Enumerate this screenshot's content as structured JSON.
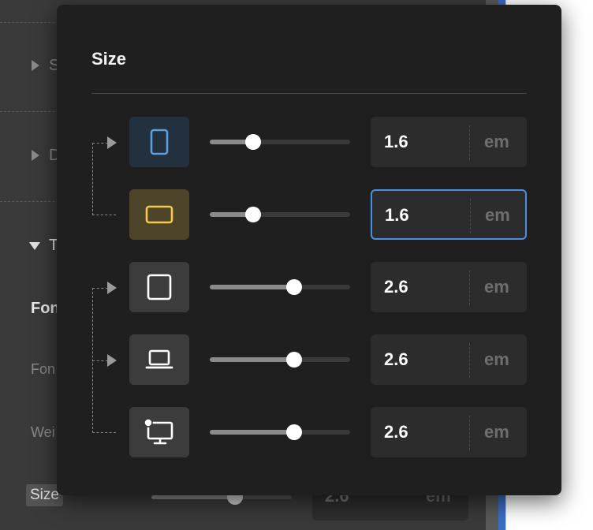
{
  "background_panel": {
    "sections": [
      {
        "label": "S"
      },
      {
        "label": "D"
      },
      {
        "label": "T"
      }
    ],
    "font_heading": "Fon",
    "font_label": "Fon",
    "weight_label": "Wei",
    "size_label": "Size",
    "size_value": "2.6",
    "size_unit": "em",
    "slider_fraction": 0.6
  },
  "popover": {
    "title": "Size",
    "rows": [
      {
        "device": "phone-portrait",
        "value": "1.6",
        "unit": "em",
        "slider_fraction": 0.31,
        "focused": false,
        "accent": "#5aa0e0"
      },
      {
        "device": "phone-landscape",
        "value": "1.6",
        "unit": "em",
        "slider_fraction": 0.31,
        "focused": true,
        "accent": "#f2c94c"
      },
      {
        "device": "tablet",
        "value": "2.6",
        "unit": "em",
        "slider_fraction": 0.6,
        "focused": false,
        "accent": "#ffffff"
      },
      {
        "device": "laptop",
        "value": "2.6",
        "unit": "em",
        "slider_fraction": 0.6,
        "focused": false,
        "accent": "#ffffff"
      },
      {
        "device": "desktop",
        "value": "2.6",
        "unit": "em",
        "slider_fraction": 0.6,
        "focused": false,
        "accent": "#ffffff"
      }
    ]
  },
  "colors": {
    "focus_ring": "#4a90e2",
    "popover_bg": "#1f1f1f",
    "panel_bg": "#3a3a3a"
  }
}
